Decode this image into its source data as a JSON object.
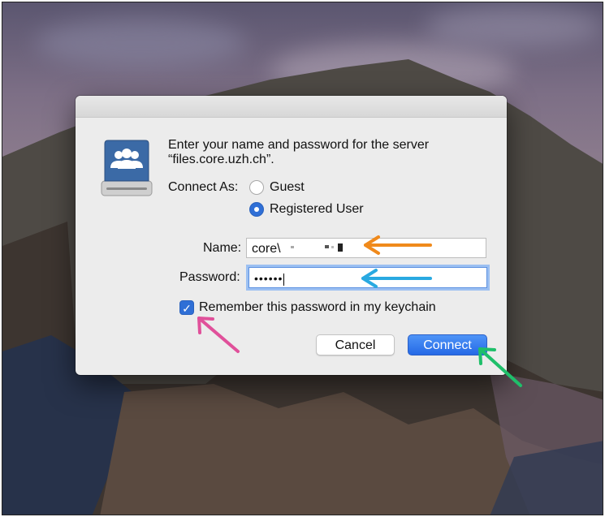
{
  "dialog": {
    "prompt_line1": "Enter your name and password for the server",
    "prompt_line2": "“files.core.uzh.ch”.",
    "connect_as_label": "Connect As:",
    "options": [
      {
        "label": "Guest",
        "selected": false
      },
      {
        "label": "Registered User",
        "selected": true
      }
    ],
    "name_label": "Name:",
    "name_value": "core\\",
    "password_label": "Password:",
    "password_value": "••••••",
    "remember_label": "Remember this password in my keychain",
    "remember_checked": true,
    "cancel_label": "Cancel",
    "connect_label": "Connect"
  },
  "annotations": {
    "colors": {
      "name_arrow": "#f08a1c",
      "password_arrow": "#29a9e1",
      "checkbox_arrow": "#e0509a",
      "connect_arrow": "#1fbf6a"
    }
  },
  "icons": {
    "server": "server-drive-icon",
    "checkmark": "checkmark-icon"
  }
}
